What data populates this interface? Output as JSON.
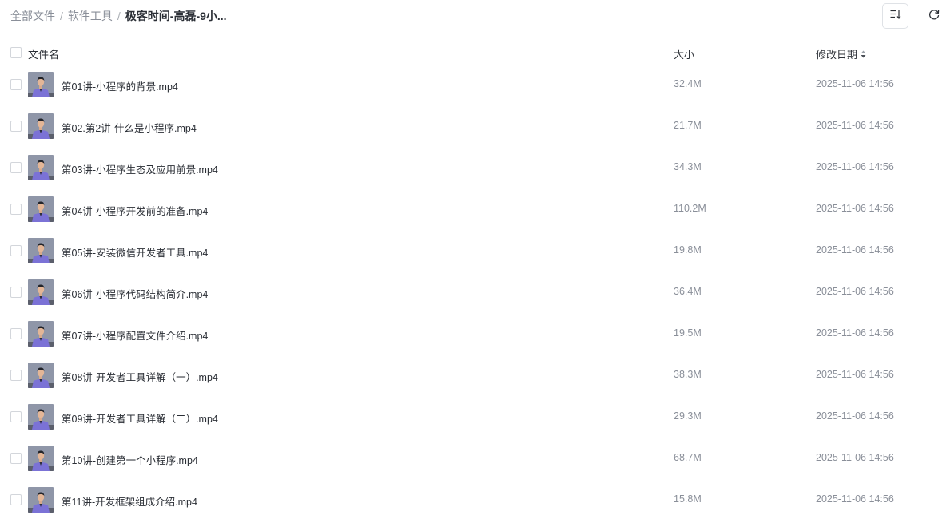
{
  "breadcrumb": {
    "items": [
      "全部文件",
      "软件工具"
    ],
    "separator": "/",
    "current": "极客时间-高磊-9小..."
  },
  "toolbar": {
    "sort_icon": "sort-list-icon",
    "refresh_icon": "refresh-icon"
  },
  "table": {
    "headers": {
      "name": "文件名",
      "size": "大小",
      "date": "修改日期"
    },
    "rows": [
      {
        "name": "第01讲-小程序的背景.mp4",
        "size": "32.4M",
        "date": "2025-11-06 14:56"
      },
      {
        "name": "第02.第2讲-什么是小程序.mp4",
        "size": "21.7M",
        "date": "2025-11-06 14:56"
      },
      {
        "name": "第03讲-小程序生态及应用前景.mp4",
        "size": "34.3M",
        "date": "2025-11-06 14:56"
      },
      {
        "name": "第04讲-小程序开发前的准备.mp4",
        "size": "110.2M",
        "date": "2025-11-06 14:56"
      },
      {
        "name": "第05讲-安装微信开发者工具.mp4",
        "size": "19.8M",
        "date": "2025-11-06 14:56"
      },
      {
        "name": "第06讲-小程序代码结构简介.mp4",
        "size": "36.4M",
        "date": "2025-11-06 14:56"
      },
      {
        "name": "第07讲-小程序配置文件介绍.mp4",
        "size": "19.5M",
        "date": "2025-11-06 14:56"
      },
      {
        "name": "第08讲-开发者工具详解（一）.mp4",
        "size": "38.3M",
        "date": "2025-11-06 14:56"
      },
      {
        "name": "第09讲-开发者工具详解（二）.mp4",
        "size": "29.3M",
        "date": "2025-11-06 14:56"
      },
      {
        "name": "第10讲-创建第一个小程序.mp4",
        "size": "68.7M",
        "date": "2025-11-06 14:56"
      },
      {
        "name": "第11讲-开发框架组成介绍.mp4",
        "size": "15.8M",
        "date": "2025-11-06 14:56"
      }
    ]
  },
  "colors": {
    "thumb_background": "#8f96a8",
    "thumb_shirt": "#7b72d6",
    "text_primary": "#2b2f36",
    "text_secondary": "#8a8f99"
  }
}
